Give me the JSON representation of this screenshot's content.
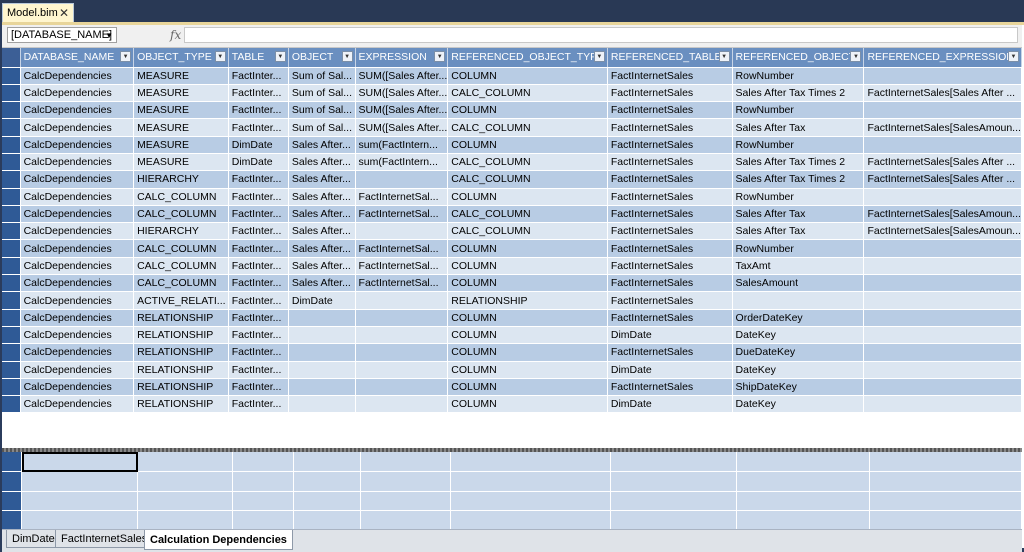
{
  "document_tab": {
    "title": "Model.bim",
    "close_glyph": "✕"
  },
  "formula_bar": {
    "name_box": "[DATABASE_NAME]",
    "fx_label": "fx",
    "formula": ""
  },
  "grid": {
    "columns": [
      "DATABASE_NAME",
      "OBJECT_TYPE",
      "TABLE",
      "OBJECT",
      "EXPRESSION",
      "REFERENCED_OBJECT_TYPE",
      "REFERENCED_TABLE",
      "REFERENCED_OBJECT",
      "REFERENCED_EXPRESSION"
    ],
    "rows": [
      [
        "CalcDependencies",
        "MEASURE",
        "FactInter...",
        "Sum of Sal...",
        "SUM([Sales After...",
        "COLUMN",
        "FactInternetSales",
        "RowNumber",
        ""
      ],
      [
        "CalcDependencies",
        "MEASURE",
        "FactInter...",
        "Sum of Sal...",
        "SUM([Sales After...",
        "CALC_COLUMN",
        "FactInternetSales",
        "Sales After Tax Times 2",
        "FactInternetSales[Sales After ..."
      ],
      [
        "CalcDependencies",
        "MEASURE",
        "FactInter...",
        "Sum of Sal...",
        "SUM([Sales After...",
        "COLUMN",
        "FactInternetSales",
        "RowNumber",
        ""
      ],
      [
        "CalcDependencies",
        "MEASURE",
        "FactInter...",
        "Sum of Sal...",
        "SUM([Sales After...",
        "CALC_COLUMN",
        "FactInternetSales",
        "Sales After Tax",
        "FactInternetSales[SalesAmoun..."
      ],
      [
        "CalcDependencies",
        "MEASURE",
        "DimDate",
        "Sales After...",
        "sum(FactIntern...",
        "COLUMN",
        "FactInternetSales",
        "RowNumber",
        ""
      ],
      [
        "CalcDependencies",
        "MEASURE",
        "DimDate",
        "Sales After...",
        "sum(FactIntern...",
        "CALC_COLUMN",
        "FactInternetSales",
        "Sales After Tax Times 2",
        "FactInternetSales[Sales After ..."
      ],
      [
        "CalcDependencies",
        "HIERARCHY",
        "FactInter...",
        "Sales After...",
        "",
        "CALC_COLUMN",
        "FactInternetSales",
        "Sales After Tax Times 2",
        "FactInternetSales[Sales After ..."
      ],
      [
        "CalcDependencies",
        "CALC_COLUMN",
        "FactInter...",
        "Sales After...",
        "FactInternetSal...",
        "COLUMN",
        "FactInternetSales",
        "RowNumber",
        ""
      ],
      [
        "CalcDependencies",
        "CALC_COLUMN",
        "FactInter...",
        "Sales After...",
        "FactInternetSal...",
        "CALC_COLUMN",
        "FactInternetSales",
        "Sales After Tax",
        "FactInternetSales[SalesAmoun..."
      ],
      [
        "CalcDependencies",
        "HIERARCHY",
        "FactInter...",
        "Sales After...",
        "",
        "CALC_COLUMN",
        "FactInternetSales",
        "Sales After Tax",
        "FactInternetSales[SalesAmoun..."
      ],
      [
        "CalcDependencies",
        "CALC_COLUMN",
        "FactInter...",
        "Sales After...",
        "FactInternetSal...",
        "COLUMN",
        "FactInternetSales",
        "RowNumber",
        ""
      ],
      [
        "CalcDependencies",
        "CALC_COLUMN",
        "FactInter...",
        "Sales After...",
        "FactInternetSal...",
        "COLUMN",
        "FactInternetSales",
        "TaxAmt",
        ""
      ],
      [
        "CalcDependencies",
        "CALC_COLUMN",
        "FactInter...",
        "Sales After...",
        "FactInternetSal...",
        "COLUMN",
        "FactInternetSales",
        "SalesAmount",
        ""
      ],
      [
        "CalcDependencies",
        "ACTIVE_RELATI...",
        "FactInter...",
        "DimDate",
        "",
        "RELATIONSHIP",
        "FactInternetSales",
        "",
        ""
      ],
      [
        "CalcDependencies",
        "RELATIONSHIP",
        "FactInter...",
        "",
        "",
        "COLUMN",
        "FactInternetSales",
        "OrderDateKey",
        ""
      ],
      [
        "CalcDependencies",
        "RELATIONSHIP",
        "FactInter...",
        "",
        "",
        "COLUMN",
        "DimDate",
        "DateKey",
        ""
      ],
      [
        "CalcDependencies",
        "RELATIONSHIP",
        "FactInter...",
        "",
        "",
        "COLUMN",
        "FactInternetSales",
        "DueDateKey",
        ""
      ],
      [
        "CalcDependencies",
        "RELATIONSHIP",
        "FactInter...",
        "",
        "",
        "COLUMN",
        "DimDate",
        "DateKey",
        ""
      ],
      [
        "CalcDependencies",
        "RELATIONSHIP",
        "FactInter...",
        "",
        "",
        "COLUMN",
        "FactInternetSales",
        "ShipDateKey",
        ""
      ],
      [
        "CalcDependencies",
        "RELATIONSHIP",
        "FactInter...",
        "",
        "",
        "COLUMN",
        "DimDate",
        "DateKey",
        ""
      ]
    ]
  },
  "sheet_tabs": [
    "DimDate",
    "FactInternetSales",
    "Calculation Dependencies"
  ],
  "active_sheet": "Calculation Dependencies",
  "colors": {
    "header": "#6a8fc0",
    "row_dark": "#b8cce4",
    "row_light": "#dce6f1",
    "row_selector": "#2f5a96"
  }
}
